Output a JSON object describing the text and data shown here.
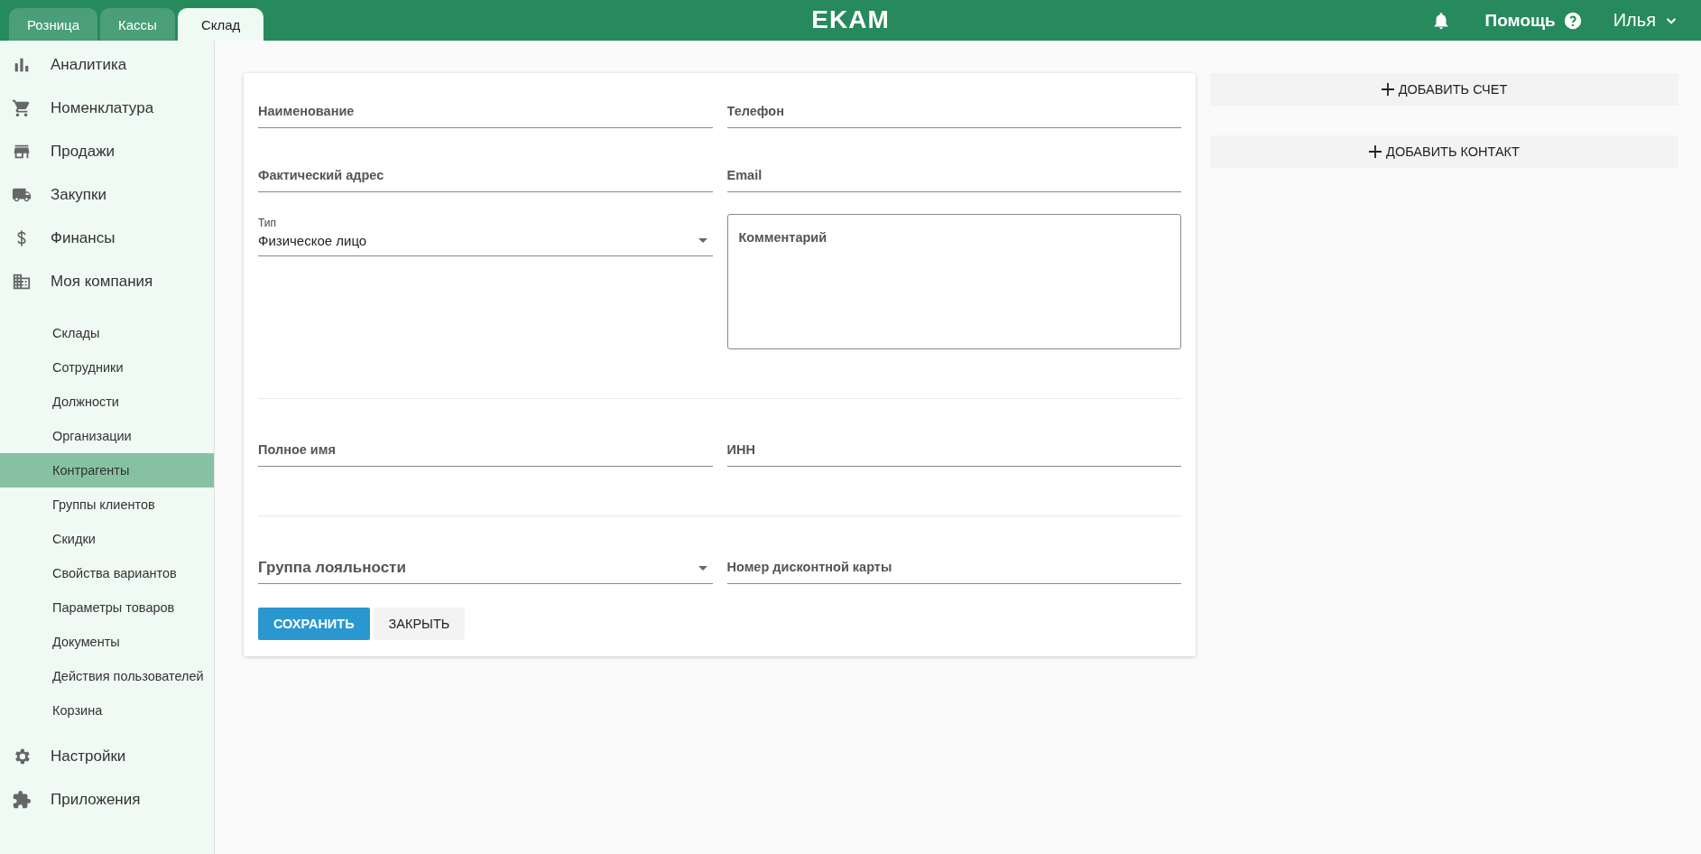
{
  "header": {
    "tabs": [
      {
        "label": "Розница",
        "selected": false
      },
      {
        "label": "Кассы",
        "selected": false
      },
      {
        "label": "Склад",
        "selected": true
      }
    ],
    "logo": "EKAM",
    "help": "Помощь",
    "user": "Илья"
  },
  "sidebar": {
    "items": [
      {
        "label": "Аналитика"
      },
      {
        "label": "Номенклатура"
      },
      {
        "label": "Продажи"
      },
      {
        "label": "Закупки"
      },
      {
        "label": "Финансы"
      },
      {
        "label": "Моя компания",
        "children": [
          {
            "label": "Склады",
            "selected": false
          },
          {
            "label": "Сотрудники",
            "selected": false
          },
          {
            "label": "Должности",
            "selected": false
          },
          {
            "label": "Организации",
            "selected": false
          },
          {
            "label": "Контрагенты",
            "selected": true
          },
          {
            "label": "Группы клиентов",
            "selected": false
          },
          {
            "label": "Скидки",
            "selected": false
          },
          {
            "label": "Свойства вариантов",
            "selected": false
          },
          {
            "label": "Параметры товаров",
            "selected": false
          },
          {
            "label": "Документы",
            "selected": false
          },
          {
            "label": "Действия пользователей",
            "selected": false
          },
          {
            "label": "Корзина",
            "selected": false
          }
        ]
      },
      {
        "label": "Настройки"
      },
      {
        "label": "Приложения"
      }
    ]
  },
  "form": {
    "sections": [
      {
        "left": [
          {
            "kind": "text",
            "placeholder": "Наименование"
          },
          {
            "kind": "text",
            "placeholder": "Фактический адрес"
          },
          {
            "kind": "select",
            "label": "Тип",
            "value": "Физическое лицо"
          }
        ],
        "right": [
          {
            "kind": "text",
            "placeholder": "Телефон"
          },
          {
            "kind": "text",
            "placeholder": "Email"
          },
          {
            "kind": "textarea",
            "placeholder": "Комментарий"
          }
        ]
      },
      {
        "left": [
          {
            "kind": "text",
            "placeholder": "Полное имя"
          }
        ],
        "right": [
          {
            "kind": "text",
            "placeholder": "ИНН"
          }
        ]
      },
      {
        "left": [
          {
            "kind": "select-empty",
            "placeholder": "Группа лояльности"
          }
        ],
        "right": [
          {
            "kind": "text",
            "placeholder": "Номер дисконтной карты"
          }
        ]
      }
    ],
    "buttons": [
      {
        "label": "СОХРАНИТЬ",
        "kind": "primary"
      },
      {
        "label": "ЗАКРЫТЬ",
        "kind": "flat"
      }
    ]
  },
  "side_actions": [
    "ДОБАВИТЬ СЧЕТ",
    "ДОБАВИТЬ КОНТАКТ"
  ]
}
